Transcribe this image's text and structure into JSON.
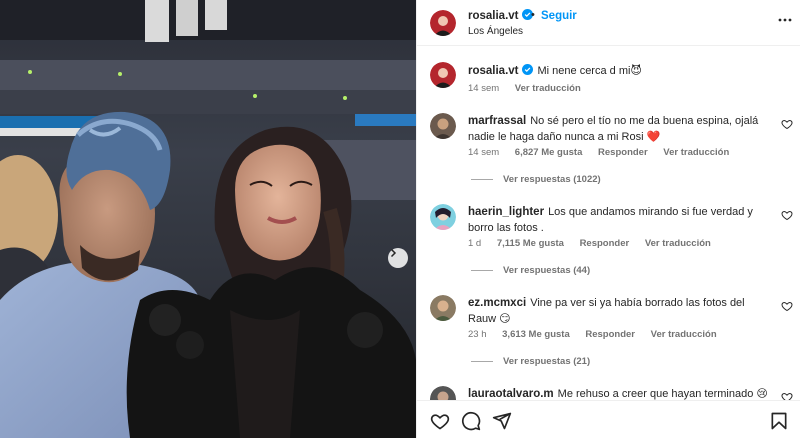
{
  "post": {
    "username": "rosalia.vt",
    "follow_label": "Seguir",
    "separator": "•",
    "location": "Los Ángeles"
  },
  "caption": {
    "username": "rosalia.vt",
    "text": "Mi nene cerca d mi😈",
    "time": "14 sem",
    "translate": "Ver traducción"
  },
  "comments": [
    {
      "username": "marfrassal",
      "text": "No sé pero el tío no me da buena espina, ojalá nadie le haga daño nunca a mi Rosi ❤️",
      "time": "14 sem",
      "likes": "6,827 Me gusta",
      "reply": "Responder",
      "translate": "Ver traducción",
      "replies": "Ver respuestas (1022)"
    },
    {
      "username": "haerin_lighter",
      "text": "Los que andamos mirando si fue verdad y borro las fotos .",
      "time": "1 d",
      "likes": "7,115 Me gusta",
      "reply": "Responder",
      "translate": "Ver traducción",
      "replies": "Ver respuestas (44)"
    },
    {
      "username": "ez.mcmxci",
      "text": "Vine pa ver si ya había borrado las fotos del Rauw 😏",
      "time": "23 h",
      "likes": "3,613 Me gusta",
      "reply": "Responder",
      "translate": "Ver traducción",
      "replies": "Ver respuestas (21)"
    },
    {
      "username": "lauraotalvaro.m",
      "text": "Me rehuso a creer que hayan terminado 😢"
    }
  ],
  "icons": {
    "verified": "verified-badge-icon",
    "more": "more-options-icon",
    "heart": "heart-icon",
    "comment": "comment-icon",
    "share": "share-icon",
    "save": "bookmark-icon",
    "next": "chevron-right-icon"
  },
  "colors": {
    "accent_blue": "#0095f6",
    "text": "#262626",
    "muted": "#737373",
    "heart_red": "#ed4956"
  }
}
